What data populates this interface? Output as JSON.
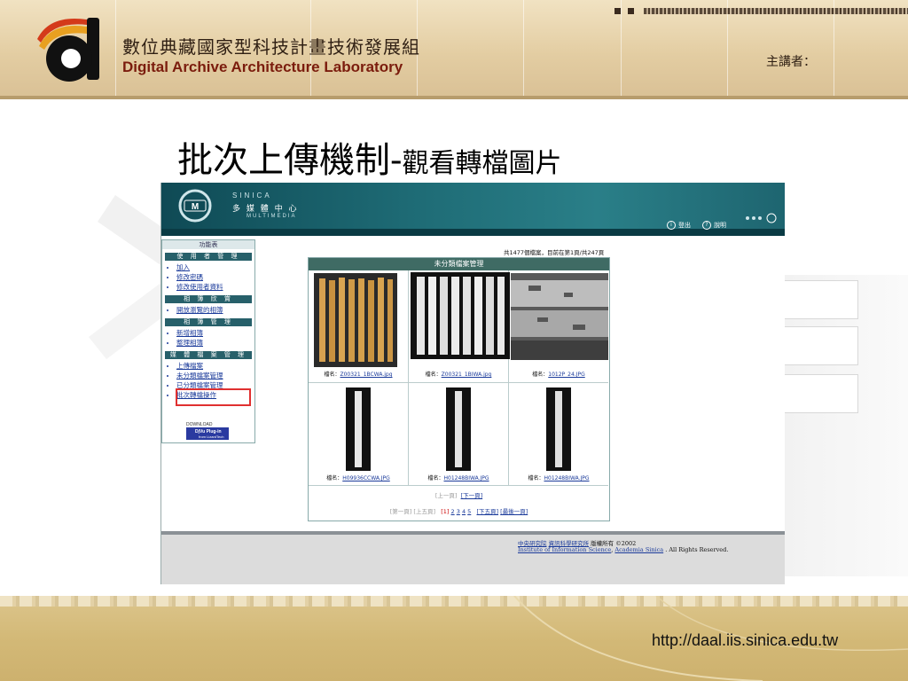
{
  "header": {
    "org_name_cn": "數位典藏國家型科技計畫技術發展組",
    "org_name_en": "Digital Archive Architecture Laboratory",
    "speaker_label": "主講者："
  },
  "slide": {
    "title_main": "批次上傳機制-",
    "title_sub": "觀看轉檔圖片"
  },
  "screenshot": {
    "brand": {
      "sinica": "SINICA",
      "center_cn": "多 媒 體 中 心",
      "center_en": "MULTIMEDIA"
    },
    "top_buttons": [
      {
        "icon": "i",
        "label": "登出"
      },
      {
        "icon": "?",
        "label": "說明"
      }
    ],
    "sidebar": {
      "title": "功能表",
      "sections": [
        {
          "title": "使 用 者 管 理",
          "items": [
            "加入",
            "修改密碼",
            "修改使用者資料"
          ]
        },
        {
          "title": "相 簿 欣 賞",
          "items": [
            "開放瀏覽的相簿"
          ]
        },
        {
          "title": "相 簿 管 理",
          "items": [
            "新增相簿",
            "整理相簿"
          ]
        },
        {
          "title": "媒 體 檔 案 管 理",
          "items": [
            "上傳檔案",
            "未分類檔案管理",
            "已分類檔案管理",
            "批次轉檔操作"
          ]
        }
      ],
      "highlighted_item": "未分類檔案管理",
      "download": {
        "top": "DOWNLOAD",
        "label": "DjVu Plug-in",
        "sub": "from LizardTech"
      }
    },
    "pager_info": "共1477個檔案，目前在第1頁/共247頁",
    "grid_title": "未分類檔案管理",
    "files": [
      {
        "label": "檔名：",
        "name": "Z00321_1BCWA.jpg"
      },
      {
        "label": "檔名：",
        "name": "Z00321_1BIWA.jpg"
      },
      {
        "label": "檔名：",
        "name": "1012P_24.JPG"
      },
      {
        "label": "檔名：",
        "name": "H09936CCWA.JPG"
      },
      {
        "label": "檔名：",
        "name": "H01248BIWA.JPG"
      },
      {
        "label": "檔名：",
        "name": "H01248BIWA.JPG"
      }
    ],
    "nav_row1": {
      "prev": "[上一頁]",
      "next": "[下一頁]"
    },
    "nav_row2": {
      "first": "[第一頁]",
      "prev_five": "[上五頁]",
      "current": "[1]",
      "pages": [
        "2",
        "3",
        "4",
        "5"
      ],
      "next_five": "[下五頁]",
      "last": "[最後一頁]"
    },
    "footer": {
      "line1_links": [
        "中央研究院",
        "資訊科學研究所"
      ],
      "line1_text": "版權所有 ©2002",
      "line2_links": [
        "Institute of Information Science",
        "Academia Sinica"
      ],
      "line2_sep": ",",
      "line2_text": ". All Rights Reserved."
    }
  },
  "footer": {
    "url": "http://daal.iis.sinica.edu.tw"
  }
}
